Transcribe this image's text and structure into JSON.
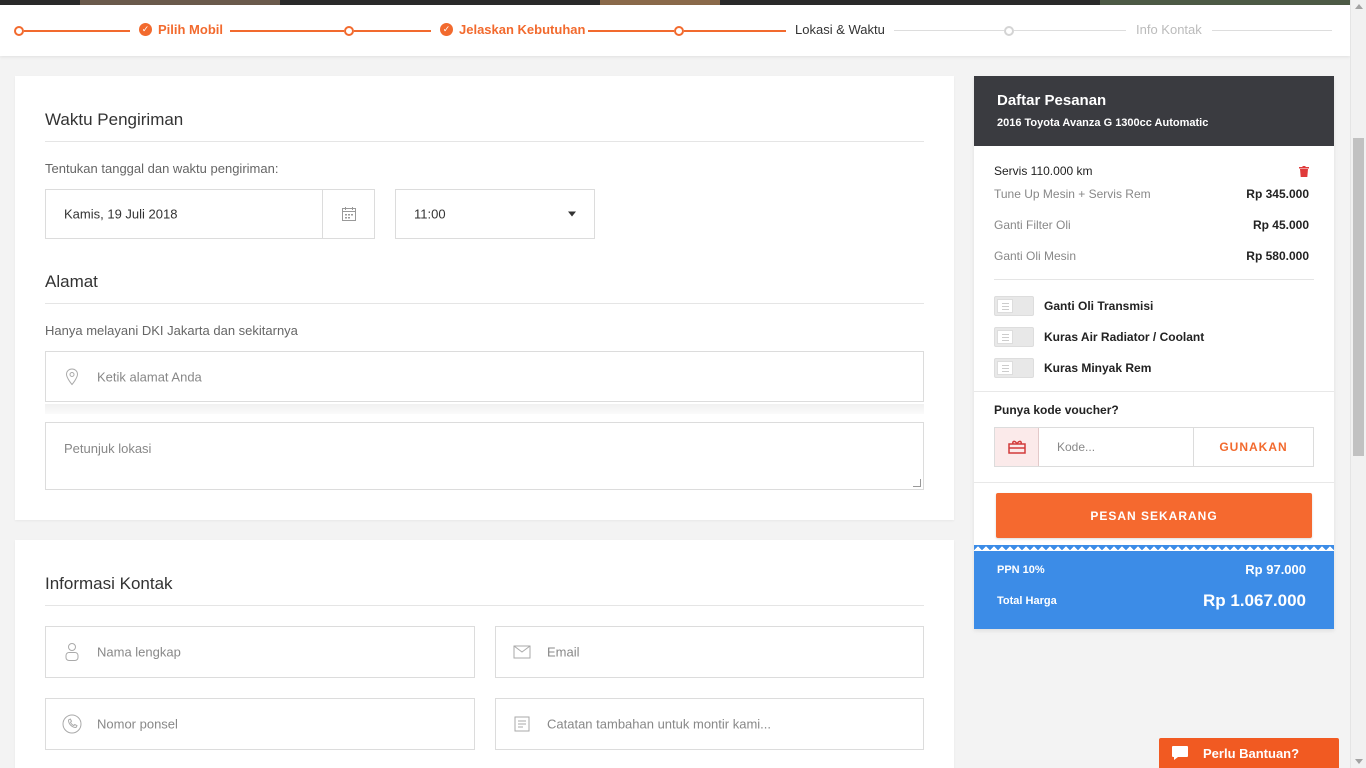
{
  "stepper": {
    "steps": [
      {
        "label": "Pilih Mobil",
        "state": "done"
      },
      {
        "label": "Jelaskan Kebutuhan",
        "state": "done"
      },
      {
        "label": "Lokasi & Waktu",
        "state": "current"
      },
      {
        "label": "Info Kontak",
        "state": "future"
      }
    ]
  },
  "delivery": {
    "title": "Waktu Pengiriman",
    "hint": "Tentukan tanggal dan waktu pengiriman:",
    "date_value": "Kamis, 19 Juli 2018",
    "time_value": "11:00"
  },
  "address": {
    "title": "Alamat",
    "hint": "Hanya melayani DKI Jakarta dan sekitarnya",
    "address_placeholder": "Ketik alamat Anda",
    "directions_placeholder": "Petunjuk lokasi"
  },
  "contact": {
    "title": "Informasi Kontak",
    "name_placeholder": "Nama lengkap",
    "email_placeholder": "Email",
    "phone_placeholder": "Nomor ponsel",
    "notes_placeholder": "Catatan tambahan untuk montir kami..."
  },
  "order": {
    "title": "Daftar Pesanan",
    "vehicle": "2016 Toyota Avanza G 1300cc Automatic",
    "service_title": "Servis 110.000 km",
    "items": [
      {
        "name": "Tune Up Mesin + Servis Rem",
        "price": "Rp 345.000"
      },
      {
        "name": "Ganti Filter Oli",
        "price": "Rp 45.000"
      },
      {
        "name": "Ganti Oli Mesin",
        "price": "Rp 580.000"
      }
    ],
    "addons": [
      {
        "name": "Ganti Oli Transmisi",
        "enabled": false
      },
      {
        "name": "Kuras Air Radiator / Coolant",
        "enabled": false
      },
      {
        "name": "Kuras Minyak Rem",
        "enabled": false
      }
    ],
    "voucher_question": "Punya kode voucher?",
    "voucher_placeholder": "Kode...",
    "voucher_button": "GUNAKAN",
    "order_button": "PESAN SEKARANG",
    "vat_label": "PPN 10%",
    "vat_value": "Rp 97.000",
    "total_label": "Total Harga",
    "total_value": "Rp 1.067.000"
  },
  "help": {
    "label": "Perlu Bantuan?"
  },
  "colors": {
    "accent": "#f26a2e",
    "totals_bg": "#3c8ce7",
    "header_dark": "#3a3b40"
  }
}
